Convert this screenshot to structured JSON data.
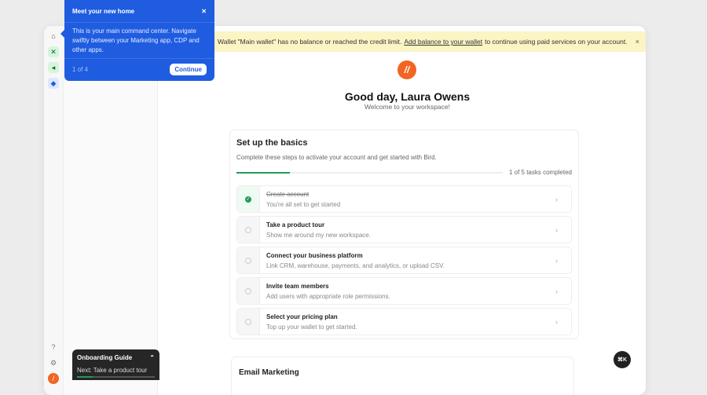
{
  "tooltip": {
    "title": "Meet your new home",
    "body": "This is your main command center. Navigate swiftly between your Marketing app, CDP and other apps.",
    "step": "1 of 4",
    "continue_label": "Continue",
    "close": "✕"
  },
  "banner": {
    "pre": "Wallet \"Main wallet\" has no balance or reached the credit limit.",
    "link": "Add balance to your wallet",
    "post": "to continue using paid services on your account.",
    "close": "×"
  },
  "header": {
    "logo": "//",
    "greeting": "Good day, Laura Owens",
    "subtitle": "Welcome to your workspace!"
  },
  "basics": {
    "title": "Set up the basics",
    "description": "Complete these steps to activate your account and get started with Bird.",
    "progress_fraction": 0.2,
    "progress_label": "1 of 5 tasks completed",
    "tasks": [
      {
        "title": "Create account",
        "subtitle": "You're all set to get started",
        "done": true
      },
      {
        "title": "Take a product tour",
        "subtitle": "Show me around my new workspace.",
        "done": false
      },
      {
        "title": "Connect your business platform",
        "subtitle": "Link CRM, warehouse, payments, and analytics, or upload CSV.",
        "done": false
      },
      {
        "title": "Invite team members",
        "subtitle": "Add users with appropriate role permissions.",
        "done": false
      },
      {
        "title": "Select your pricing plan",
        "subtitle": "Top up your wallet to get started.",
        "done": false
      }
    ]
  },
  "email_marketing": {
    "title": "Email Marketing"
  },
  "guide": {
    "title": "Onboarding Guide",
    "next": "Next: Take a product tour",
    "progress_fraction": 0.2
  },
  "cmdk": "⌘K",
  "colors": {
    "accent": "#1f5ce0",
    "success": "#1f9d55",
    "brand": "#f26522",
    "banner": "#fbf4c4"
  }
}
